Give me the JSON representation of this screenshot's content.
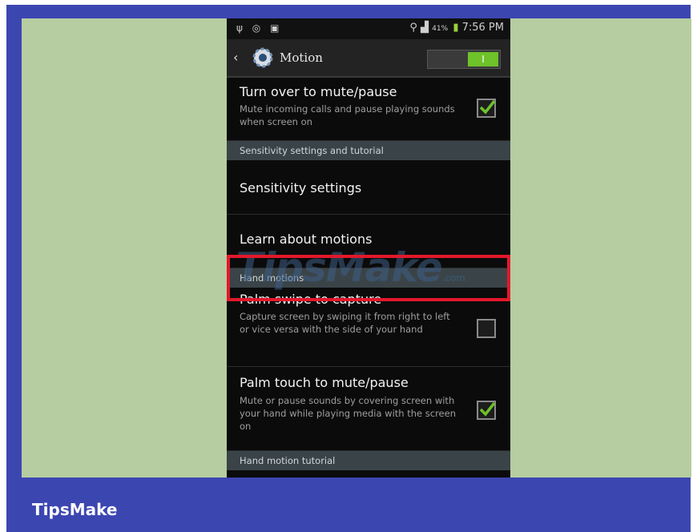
{
  "status_bar": {
    "left_icons": [
      "usb-icon",
      "sync-icon",
      "image-icon"
    ],
    "battery_percent": "41%",
    "time": "7:56 PM"
  },
  "app_bar": {
    "title": "Motion",
    "toggle_label": "I"
  },
  "items": {
    "turn_over": {
      "title": "Turn over to mute/pause",
      "subtitle": "Mute incoming calls and pause playing sounds when screen on",
      "checked": true
    },
    "sens_header": "Sensitivity settings and tutorial",
    "sensitivity": "Sensitivity settings",
    "learn": "Learn about motions",
    "hand_header": "Hand motions",
    "palm_swipe": {
      "title": "Palm swipe to capture",
      "subtitle": "Capture screen by swiping it from right to left or vice versa with the side of your hand",
      "checked": false
    },
    "palm_touch": {
      "title": "Palm touch to mute/pause",
      "subtitle": "Mute or pause sounds by covering screen with your hand while playing media with the screen on",
      "checked": true
    },
    "tutorial_header": "Hand motion tutorial"
  },
  "watermark": {
    "text": "TipsMake",
    "suffix": ".com"
  },
  "brand": "TipsMake",
  "colors": {
    "frame_blue": "#3c46b1",
    "background_green": "#b6cda1",
    "highlight_red": "#e3182b",
    "check_green": "#6ec22a"
  }
}
